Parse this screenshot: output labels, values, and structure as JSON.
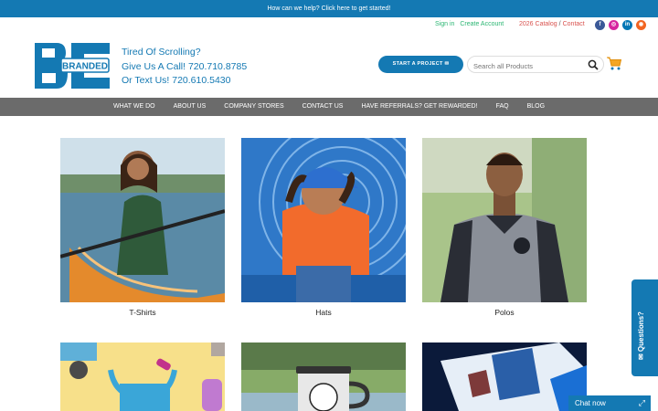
{
  "topbar": {
    "text": "How can we help? Click here to get started!"
  },
  "util": {
    "sign_in": "Sign in",
    "create_account": "Create Account",
    "catalog": "2026 Catalog",
    "separator": "/",
    "contact": "Contact",
    "social": [
      {
        "name": "facebook-icon",
        "glyph": "f",
        "color": "#3b5998"
      },
      {
        "name": "instagram-icon",
        "glyph": "◎",
        "color": "#d6249f"
      },
      {
        "name": "linkedin-icon",
        "glyph": "in",
        "color": "#0077b5"
      },
      {
        "name": "rss-icon",
        "glyph": "◉",
        "color": "#f26522"
      }
    ]
  },
  "logo": {
    "text": "BRANDED",
    "color": "#1479b3"
  },
  "tagline": {
    "line1": "Tired Of Scrolling?",
    "line2": "Give Us A Call! 720.710.8785",
    "line3": "Or Text Us! 720.610.5430"
  },
  "header": {
    "start_label": "START A PROJECT ✉",
    "search_placeholder": "Search all Products"
  },
  "nav": [
    "WHAT WE DO",
    "ABOUT US",
    "COMPANY STORES",
    "CONTACT US",
    "HAVE REFERRALS? GET REWARDED!",
    "FAQ",
    "BLOG"
  ],
  "products": [
    {
      "label": "T-Shirts"
    },
    {
      "label": "Hats"
    },
    {
      "label": "Polos"
    }
  ],
  "widgets": {
    "chat_label": "Chat now",
    "questions_label": "✉ Questions?"
  },
  "colors": {
    "brand": "#1479b3",
    "nav": "#6b6b6b",
    "accent_green": "#2bb673",
    "accent_red": "#d9534f"
  }
}
